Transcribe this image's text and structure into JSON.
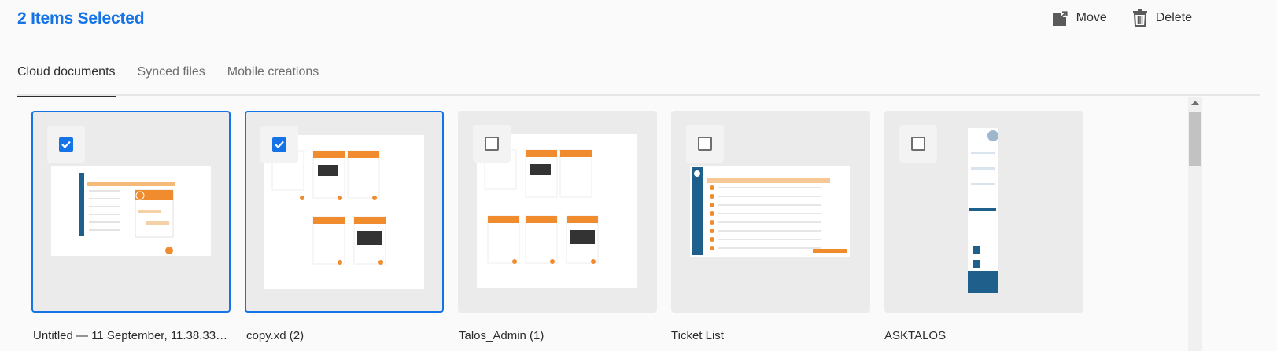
{
  "header": {
    "title": "2 Items Selected",
    "move_label": "Move",
    "delete_label": "Delete"
  },
  "tabs": [
    {
      "label": "Cloud documents",
      "active": true
    },
    {
      "label": "Synced files",
      "active": false
    },
    {
      "label": "Mobile creations",
      "active": false
    }
  ],
  "documents": [
    {
      "name": "Untitled — 11 September, 11.38.33…",
      "selected": true
    },
    {
      "name": "copy.xd (2)",
      "selected": true
    },
    {
      "name": "Talos_Admin (1)",
      "selected": false
    },
    {
      "name": "Ticket List",
      "selected": false
    },
    {
      "name": "ASKTALOS",
      "selected": false
    }
  ],
  "colors": {
    "accent": "#1473e6",
    "thumb_orange": "#f08c2e",
    "thumb_navy": "#1f5f8b"
  }
}
